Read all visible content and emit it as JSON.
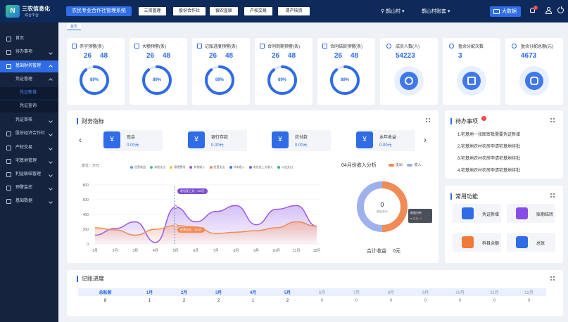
{
  "app": {
    "logo_text": "三农信息化",
    "logo_sub": "综合平台",
    "system_title": "农民专业合作社管理系统"
  },
  "topnav": [
    "三资管理",
    "股份合作社",
    "银农直联",
    "产权交易",
    "清产核资"
  ],
  "location": {
    "village": "鹊山村",
    "account": "鹊山村账套"
  },
  "bigdata_label": "大数据",
  "notification_count": "2",
  "breadcrumb": "首页",
  "sidebar": {
    "items": [
      {
        "label": "首页"
      },
      {
        "label": "待办事项"
      },
      {
        "label": "基础财务管理"
      },
      {
        "label": "凭证管理"
      },
      {
        "label": "凭证新增"
      },
      {
        "label": "凭证查询"
      },
      {
        "label": "凭证审核"
      },
      {
        "label": "股份经济合作社"
      },
      {
        "label": "产权交易"
      },
      {
        "label": "宅基地管理"
      },
      {
        "label": "利益联结管理"
      },
      {
        "label": "预警监控"
      },
      {
        "label": "基础数据"
      }
    ]
  },
  "warnings": [
    {
      "title": "赤字预警(条)",
      "a": "26",
      "b": "48",
      "pct": "89%",
      "level": 0.89
    },
    {
      "title": "大额预警(条)",
      "a": "26",
      "b": "48",
      "pct": "89%",
      "level": 0.89
    },
    {
      "title": "记账进度预警(条)",
      "a": "26",
      "b": "48",
      "pct": "89%",
      "level": 0.89
    },
    {
      "title": "合同到期预警(条)",
      "a": "26",
      "b": "48",
      "pct": "89%",
      "level": 0.89
    },
    {
      "title": "合同结款预警(条)",
      "a": "26",
      "b": "48",
      "pct": "89%",
      "level": 0.89
    }
  ],
  "stats": [
    {
      "title": "成员人数(人)",
      "value": "54223"
    },
    {
      "title": "盈余分配次数",
      "value": "3"
    },
    {
      "title": "盈余分配总额(元)",
      "value": "4673"
    }
  ],
  "finance": {
    "title": "财务指标",
    "cards": [
      {
        "label": "现金",
        "value": "0.00元"
      },
      {
        "label": "银行存款",
        "value": "0.00元"
      },
      {
        "label": "应付款",
        "value": "0.00元"
      },
      {
        "label": "本年收益",
        "value": "0.00元"
      }
    ],
    "unit": "单位：万元",
    "legend": [
      "经营收益",
      "其他支出",
      "管理费用",
      "其他收入",
      "经营支出",
      "补助收入",
      "发包及上交收入",
      "公益支出"
    ],
    "tooltip_a": "发包及上交：759万",
    "tooltip_b": "经营支出：324万"
  },
  "chart_data": {
    "type": "area",
    "categories": [
      "1月",
      "2月",
      "3月",
      "4月",
      "5月",
      "6月",
      "7月",
      "8月",
      "9月",
      "10月",
      "11月",
      "12月"
    ],
    "yticks": [
      "0",
      "200",
      "400",
      "600",
      "800"
    ],
    "ylim": [
      0,
      800
    ],
    "series": [
      {
        "name": "其他收入",
        "values": [
          120,
          210,
          300,
          20,
          500,
          300,
          440,
          520,
          260,
          470,
          520,
          240
        ]
      },
      {
        "name": "经营支出",
        "values": [
          220,
          190,
          120,
          200,
          250,
          230,
          140,
          160,
          180,
          220,
          300,
          240
        ]
      }
    ]
  },
  "april_income": {
    "title": "04月份收入分析",
    "legend": [
      "支出",
      "收入"
    ],
    "center_value": "0",
    "center_label": "收益合计",
    "tip_title": "收益分析",
    "tip_value": "● 支出: 0",
    "total_label": "合计收益",
    "total_value": "0元",
    "donut": [
      {
        "name": "支出",
        "value": 0.5
      },
      {
        "name": "收入",
        "value": 0.5
      }
    ]
  },
  "todo": {
    "title": "待办事项",
    "badge": "7",
    "items": [
      "1.宅基地一张图审批需要凭证新增",
      "2.宅基地农村农房申请宅基地待批",
      "3.宅基地农村农房申请宅基地待批",
      "4.宅基地农村农房申请宅基地待批"
    ]
  },
  "functions": {
    "title": "常用功能",
    "items": [
      {
        "label": "凭证新增",
        "color": "#2f6ce5"
      },
      {
        "label": "账期结转",
        "color": "#8a4ce6"
      },
      {
        "label": "科目余额",
        "color": "#f07a3a"
      },
      {
        "label": "总账",
        "color": "#2f6ce5"
      }
    ]
  },
  "ledger": {
    "title": "记账进度",
    "headers": [
      "总账套",
      "1月",
      "2月",
      "3月",
      "4月",
      "5月",
      "6月",
      "7月",
      "8月",
      "9月",
      "10月",
      "11月",
      "12月"
    ],
    "values": [
      "8",
      "1",
      "2",
      "2",
      "1",
      "2",
      "0",
      "0",
      "0",
      "0",
      "0",
      "0",
      "0"
    ]
  }
}
